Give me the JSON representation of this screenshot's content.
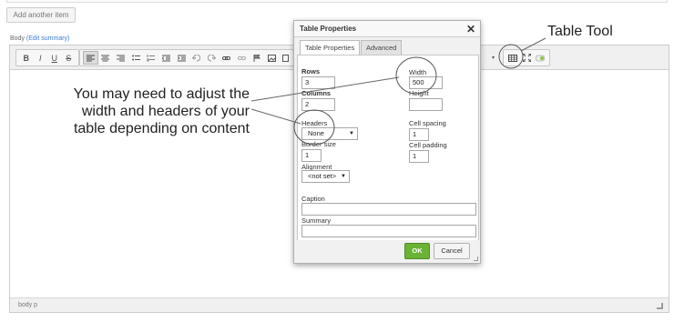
{
  "page": {
    "add_another": "Add another item",
    "body_label": "Body",
    "edit_summary": "(Edit summary)"
  },
  "toolbar": {
    "buttons_left": [
      "B",
      "I",
      "U",
      "S"
    ],
    "table_tool_icon": "table-icon",
    "maximize_icon": "maximize-icon"
  },
  "statusbar": {
    "path": "body  p"
  },
  "dialog": {
    "title": "Table Properties",
    "close": "✕",
    "tabs": [
      "Table Properties",
      "Advanced"
    ],
    "rows_label": "Rows",
    "rows_value": "3",
    "columns_label": "Columns",
    "columns_value": "2",
    "headers_label": "Headers",
    "headers_value": "None",
    "border_label": "Border size",
    "border_value": "1",
    "alignment_label": "Alignment",
    "alignment_value": "<not set>",
    "width_label": "Width",
    "width_value": "500",
    "height_label": "Height",
    "height_value": "",
    "spacing_label": "Cell spacing",
    "spacing_value": "1",
    "padding_label": "Cell padding",
    "padding_value": "1",
    "caption_label": "Caption",
    "caption_value": "",
    "summary_label": "Summary",
    "summary_value": "",
    "ok": "OK",
    "cancel": "Cancel"
  },
  "annotations": {
    "note_line1": "You may need to adjust the",
    "note_line2": "width and headers of your",
    "note_line3": "table depending on content",
    "table_tool": "Table Tool"
  },
  "colors": {
    "ok_green": "#6ab335",
    "link_blue": "#3a7bd5"
  }
}
